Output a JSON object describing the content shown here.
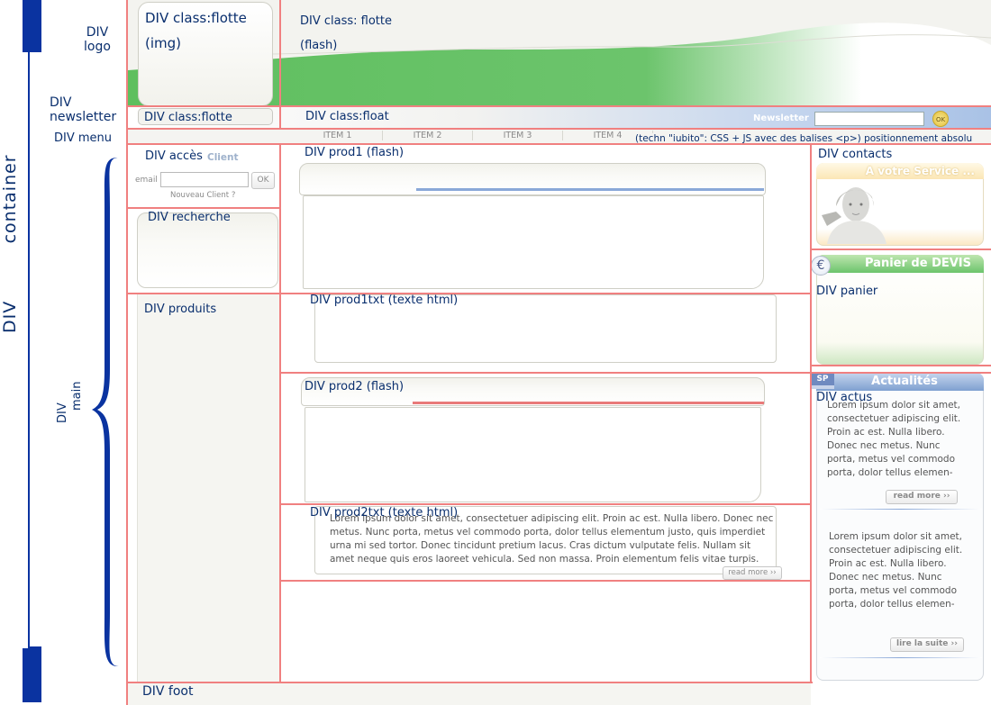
{
  "side_labels": {
    "logo": [
      "DIV",
      "logo"
    ],
    "newsletter": [
      "DIV",
      "newsletter"
    ],
    "menu": "DIV menu",
    "container": [
      "DIV",
      "container"
    ],
    "main": [
      "DIV",
      "main"
    ]
  },
  "header": {
    "logo_box": [
      "DIV class:flotte",
      "(img)"
    ],
    "flash_box": [
      "DIV class: flotte",
      "(flash)"
    ]
  },
  "newsletter_bar": {
    "left": "DIV class:flotte",
    "middle": "DIV class:float",
    "newsletter_label": "Newsletter",
    "ok": "OK"
  },
  "menu": {
    "items": [
      "ITEM 1",
      "ITEM 2",
      "ITEM 3",
      "ITEM 4"
    ],
    "note": "(techn \"iubito\": CSS + JS avec des balises <p>)  positionnement absolu"
  },
  "acces": {
    "label": "DIV accès",
    "overlay": "Client",
    "email_label": "email",
    "ok": "OK",
    "new_client": "Nouveau Client ?"
  },
  "recherche": "DIV recherche",
  "produits": "DIV produits",
  "prod1": "DIV prod1 (flash)",
  "prod1txt": "DIV prod1txt (texte html)",
  "prod2": "DIV prod2 (flash)",
  "prod2txt": {
    "label": "DIV prod2txt (texte html)",
    "lines": [
      "Lorem ipsum dolor sit amet, consectetuer adipiscing elit. Proin ac est. Nulla libero. Donec nec",
      "metus. Nunc porta, metus vel commodo porta, dolor tellus elementum justo, quis imperdiet",
      "urna mi sed tortor. Donec tincidunt pretium lacus. Cras dictum vulputate felis. Nullam sit",
      "amet neque quis eros laoreet vehicula. Sed non massa. Proin elementum felis vitae turpis."
    ],
    "read_more": "read more ››"
  },
  "contacts": {
    "label": "DIV contacts",
    "header": "A votre Service ..."
  },
  "panier": {
    "label": "DIV panier",
    "header": "Panier de DEVIS",
    "euro": "€"
  },
  "actus": {
    "label": "DIV actus",
    "header": "Actualités",
    "badge": "SP",
    "item1_lines": [
      "Lorem ipsum dolor sit amet,",
      "consectetuer adipiscing elit.",
      "Proin ac est. Nulla libero.",
      "Donec nec metus. Nunc",
      "porta, metus vel commodo",
      "porta, dolor tellus elemen-"
    ],
    "read_more": "read more ››",
    "item2_lines": [
      "Lorem ipsum dolor sit amet,",
      "consectetuer adipiscing elit.",
      "Proin ac est. Nulla libero.",
      "Donec nec metus. Nunc",
      "porta, metus vel commodo",
      "porta, dolor tellus elemen-"
    ],
    "lire_suite": "lire la suite ››"
  },
  "foot": "DIV foot",
  "colors": {
    "outline": "#f08080",
    "label_blue": "#0a2f6e",
    "bracket_blue": "#0a33a0",
    "header_green": "#6ec46e",
    "newsletter_blue": "#a9c2e6"
  }
}
